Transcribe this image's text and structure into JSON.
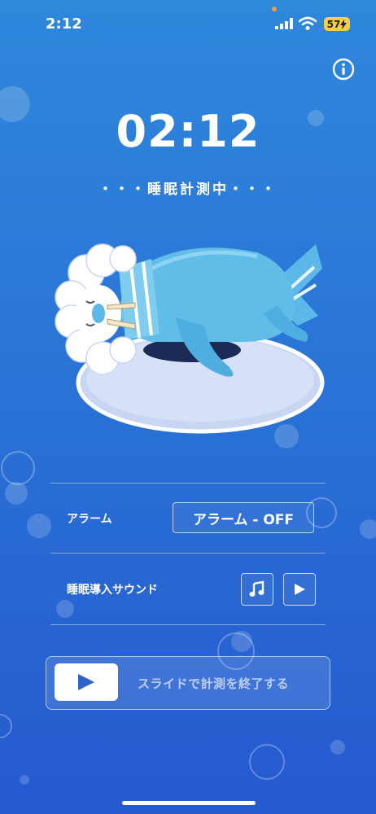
{
  "status_bar": {
    "time": "2:12",
    "battery": "57",
    "signal_icon": "signal-icon",
    "wifi_icon": "wifi-icon",
    "charging_icon": "bolt-icon"
  },
  "header": {
    "info_icon": "info-icon"
  },
  "timer": {
    "elapsed": "02:12",
    "status": "・・・睡眠計測中・・・"
  },
  "illustration": {
    "subject": "sleeping-walrus-icon"
  },
  "alarm": {
    "label": "アラーム",
    "button": "アラーム - OFF"
  },
  "sound": {
    "label": "睡眠導入サウンド",
    "music_icon": "music-note-icon",
    "play_icon": "play-icon"
  },
  "slider": {
    "text": "スライドで計測を終了する",
    "knob_icon": "play-icon"
  },
  "colors": {
    "background_top": "#2f88dc",
    "background_bottom": "#2559cf",
    "accent_blue": "#2d63c8",
    "battery": "#f4d03f"
  }
}
